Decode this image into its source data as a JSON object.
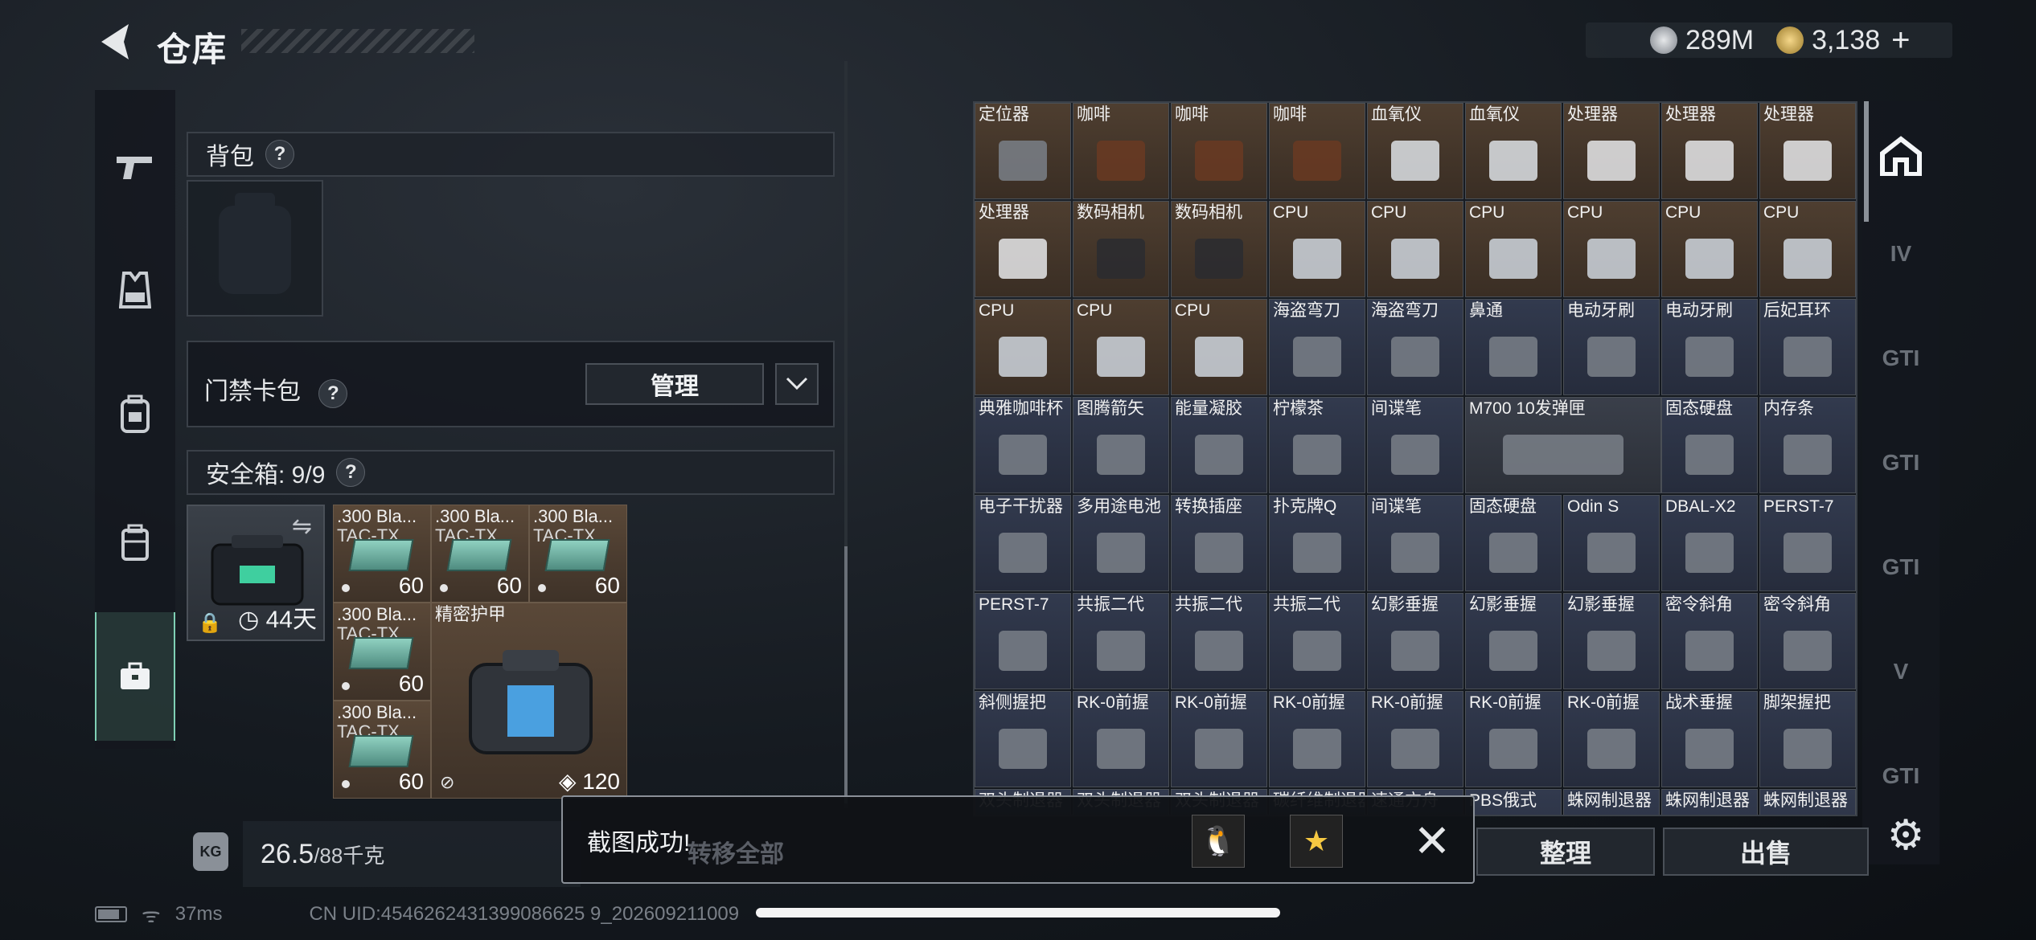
{
  "header": {
    "title": "仓库"
  },
  "currency": {
    "silver": "289M",
    "gold": "3,138",
    "plus": "+"
  },
  "left_nav": [
    {
      "icon": "pistol-icon"
    },
    {
      "icon": "vest-icon"
    },
    {
      "icon": "backpack-icon"
    },
    {
      "icon": "case-icon"
    },
    {
      "icon": "briefcase-icon",
      "active": true
    }
  ],
  "backpack": {
    "label": "背包",
    "help": "?"
  },
  "keycard": {
    "label": "门禁卡包",
    "help": "?",
    "manage": "管理",
    "dropdown": "﹀"
  },
  "safebox": {
    "label": "安全箱: 9/9",
    "help": "?",
    "time": "44天",
    "swap": "⇋",
    "lock": "🔒"
  },
  "safebox_items": [
    {
      "name": ".300 Bla...",
      "sub": "TAC-TX",
      "count": "60"
    },
    {
      "name": ".300 Bla...",
      "sub": "TAC-TX",
      "count": "60"
    },
    {
      "name": ".300 Bla...",
      "sub": "TAC-TX",
      "count": "60"
    },
    {
      "name": ".300 Bla...",
      "sub": "TAC-TX",
      "count": "60"
    },
    {
      "name": ".300 Bla...",
      "sub": "TAC-TX",
      "count": "60"
    },
    {
      "name": "精密护甲",
      "count": "120"
    }
  ],
  "weight": {
    "current": "26.5",
    "max": "/88千克",
    "icon_text": "KG"
  },
  "inventory": [
    [
      "定位器",
      "咖啡",
      "咖啡",
      "咖啡",
      "血氧仪",
      "血氧仪",
      "处理器",
      "处理器",
      "处理器"
    ],
    [
      "处理器",
      "数码相机",
      "数码相机",
      "CPU",
      "CPU",
      "CPU",
      "CPU",
      "CPU",
      "CPU"
    ],
    [
      "CPU",
      "CPU",
      "CPU",
      "海盗弯刀",
      "海盗弯刀",
      "鼻通",
      "电动牙刷",
      "电动牙刷",
      "后妃耳环"
    ],
    [
      "典雅咖啡杯",
      "图腾箭矢",
      "能量凝胶",
      "柠檬茶",
      "间谍笔",
      "M700 10发弹匣",
      "",
      "固态硬盘",
      "内存条"
    ],
    [
      "电子干扰器",
      "多用途电池",
      "转换插座",
      "扑克牌Q",
      "间谍笔",
      "固态硬盘",
      "Odin S",
      "DBAL-X2",
      "PERST-7"
    ],
    [
      "PERST-7",
      "共振二代",
      "共振二代",
      "共振二代",
      "幻影垂握",
      "幻影垂握",
      "幻影垂握",
      "密令斜角",
      "密令斜角"
    ],
    [
      "斜侧握把",
      "RK-0前握",
      "RK-0前握",
      "RK-0前握",
      "RK-0前握",
      "RK-0前握",
      "RK-0前握",
      "战术垂握",
      "脚架握把"
    ],
    [
      "双头制退器",
      "双头制退器",
      "双头制退器",
      "碳纤维制退器",
      "速通方舟",
      "PBS俄式",
      "蛛网制退器",
      "蛛网制退器",
      "蛛网制退器"
    ]
  ],
  "right_nav": [
    "home",
    "IV",
    "GTI",
    "GTI",
    "GTI",
    "V",
    "GTI"
  ],
  "buttons": {
    "organize": "整理",
    "sell": "出售",
    "transfer": "转移全部"
  },
  "toast": {
    "text": "截图成功!",
    "close": "✕"
  },
  "status": {
    "ping": "37ms",
    "uid": "CN UID:4546262431399086625 9_202609211009"
  }
}
